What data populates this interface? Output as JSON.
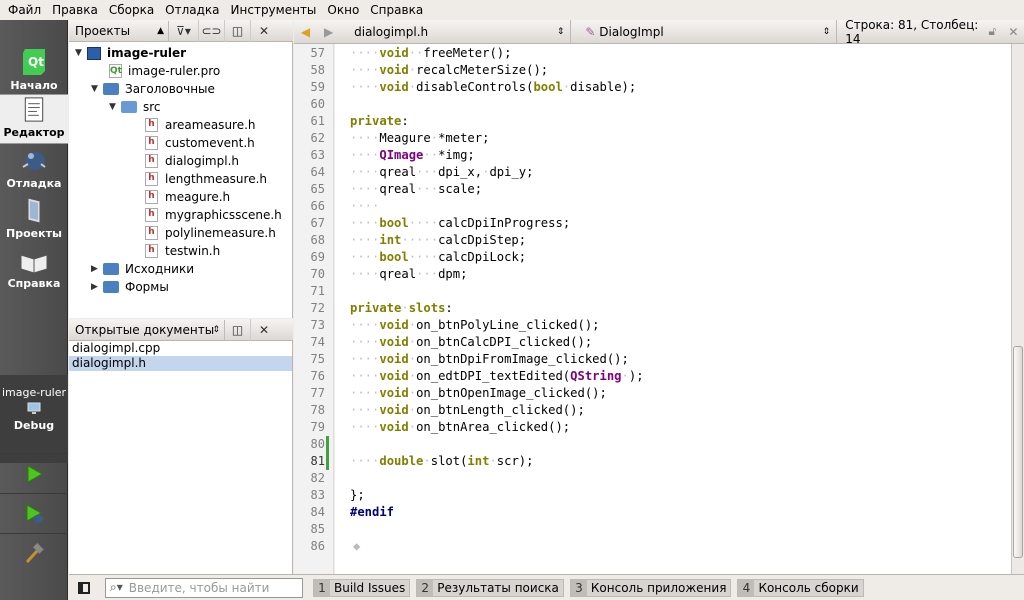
{
  "menu": [
    "Файл",
    "Правка",
    "Сборка",
    "Отладка",
    "Инструменты",
    "Окно",
    "Справка"
  ],
  "modes": [
    {
      "label": "Начало",
      "icon": "qt-logo-icon"
    },
    {
      "label": "Редактор",
      "icon": "document-icon"
    },
    {
      "label": "Отладка",
      "icon": "bug-icon"
    },
    {
      "label": "Проекты",
      "icon": "projects-icon"
    },
    {
      "label": "Справка",
      "icon": "book-icon"
    }
  ],
  "target": {
    "project": "image-ruler",
    "config": "Debug"
  },
  "projects_panel": {
    "title": "Проекты"
  },
  "tree": {
    "root": "image-ruler",
    "pro_file": "image-ruler.pro",
    "headers": "Заголовочные",
    "src": "src",
    "files": [
      "areameasure.h",
      "customevent.h",
      "dialogimpl.h",
      "lengthmeasure.h",
      "meagure.h",
      "mygraphicsscene.h",
      "polylinemeasure.h",
      "testwin.h"
    ],
    "sources": "Исходники",
    "forms": "Формы"
  },
  "open_docs": {
    "title": "Открытые документы",
    "items": [
      "dialogimpl.cpp",
      "dialogimpl.h"
    ],
    "selected": "dialogimpl.h"
  },
  "editor": {
    "file": "dialogimpl.h",
    "symbol": "DialogImpl",
    "position": "Строка: 81, Столбец: 14",
    "line_numbers": [
      "57",
      "58",
      "59",
      "60",
      "61",
      "62",
      "63",
      "64",
      "65",
      "66",
      "67",
      "68",
      "69",
      "70",
      "71",
      "72",
      "73",
      "74",
      "75",
      "76",
      "77",
      "78",
      "79",
      "80",
      "81",
      "82",
      "83",
      "84",
      "85",
      "86"
    ],
    "current_line": "81"
  },
  "status": {
    "search_placeholder": "Введите, чтобы найти",
    "tabs": [
      {
        "num": "1",
        "label": "Build Issues"
      },
      {
        "num": "2",
        "label": "Результаты поиска"
      },
      {
        "num": "3",
        "label": "Консоль приложения"
      },
      {
        "num": "4",
        "label": "Консоль сборки"
      }
    ]
  }
}
